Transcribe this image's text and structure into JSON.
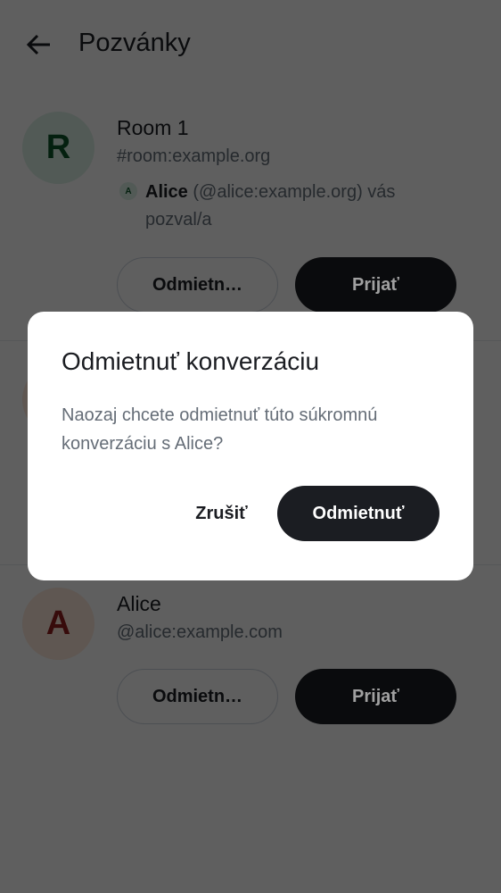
{
  "header": {
    "title": "Pozvánky"
  },
  "invites": [
    {
      "avatar": "R",
      "name": "Room 1",
      "alias": "#room:example.org",
      "inviter_avatar": "A",
      "inviter_name": "Alice",
      "inviter_text": " (@alice:example.org) vás pozval/a",
      "decline": "Odmietn…",
      "accept": "Prijať"
    },
    {
      "avatar": "A",
      "name": "Alice",
      "alias": "@alice:example.com",
      "decline": "Odmietn…",
      "accept": "Prijať"
    }
  ],
  "dialog": {
    "title": "Odmietnuť konverzáciu",
    "body": "Naozaj chcete odmietnuť túto súkromnú konverzáciu s Alice?",
    "cancel": "Zrušiť",
    "confirm": "Odmietnuť"
  }
}
